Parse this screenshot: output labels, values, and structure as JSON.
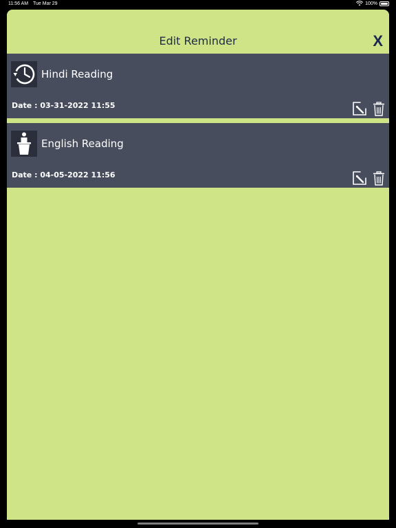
{
  "status_bar": {
    "time": "11:56 AM",
    "day": "Tue Mar 29",
    "battery": "100%"
  },
  "sheet": {
    "title": "Edit Reminder",
    "close_label": "X",
    "background_color": "#cfe387"
  },
  "reminders": [
    {
      "title": "Hindi Reading",
      "date": "Date : 03-31-2022 11:55",
      "icon": "history-clock-icon"
    },
    {
      "title": "English Reading",
      "date": "Date : 04-05-2022 11:56",
      "icon": "speaker-podium-icon"
    }
  ]
}
